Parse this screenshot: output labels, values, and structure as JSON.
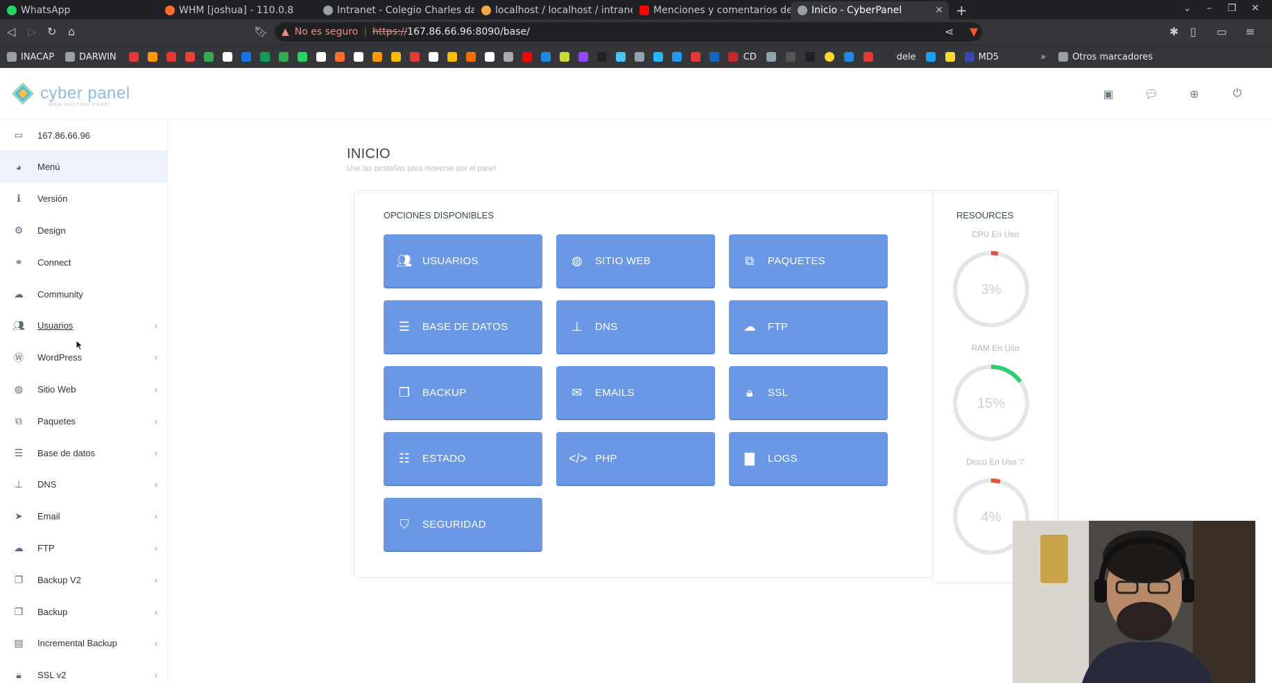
{
  "browser": {
    "tabs": [
      {
        "title": "WhatsApp",
        "color": "#25d366"
      },
      {
        "title": "WHM [joshua] - 110.0.8",
        "color": "#ff6c2c"
      },
      {
        "title": "Intranet - Colegio Charles dar",
        "color": "#9aa0a6"
      },
      {
        "title": "localhost / localhost / intranet",
        "color": "#f4a742"
      },
      {
        "title": "Menciones y comentarios del",
        "color": "#ff0000"
      },
      {
        "title": "Inicio - CyberPanel",
        "color": "#9aa0a6"
      }
    ],
    "security_label": "No es seguro",
    "url_scheme": "https://",
    "url_rest": "167.86.66.96:8090/base/",
    "bookmarks": [
      {
        "label": "INACAP"
      },
      {
        "label": "DARWIN"
      }
    ],
    "bookmark_text_items": [
      "CD",
      "dele",
      "MD5"
    ],
    "other_bookmarks": "Otros marcadores"
  },
  "header": {
    "logo_text": "cyber panel",
    "logo_sub": "WEB HOSTING PANEL",
    "icons": [
      "youtube-icon",
      "chat-icon",
      "support-icon",
      "power-icon"
    ]
  },
  "sidebar": {
    "ip": "167.86.66.96",
    "items": [
      {
        "label": "Menú",
        "icon": "dashboard-icon",
        "chevron": false
      },
      {
        "label": "Versión",
        "icon": "info-icon",
        "chevron": false
      },
      {
        "label": "Design",
        "icon": "gear-icon",
        "chevron": false
      },
      {
        "label": "Connect",
        "icon": "link-icon",
        "chevron": false
      },
      {
        "label": "Community",
        "icon": "comments-icon",
        "chevron": false
      },
      {
        "label": "Usuarios",
        "icon": "users-icon",
        "chevron": true
      },
      {
        "label": "WordPress",
        "icon": "wordpress-icon",
        "chevron": true
      },
      {
        "label": "Sitio Web",
        "icon": "globe-icon",
        "chevron": true
      },
      {
        "label": "Paquetes",
        "icon": "cubes-icon",
        "chevron": true
      },
      {
        "label": "Base de datos",
        "icon": "database-icon",
        "chevron": true
      },
      {
        "label": "DNS",
        "icon": "sitemap-icon",
        "chevron": true
      },
      {
        "label": "Email",
        "icon": "paper-plane-icon",
        "chevron": true
      },
      {
        "label": "FTP",
        "icon": "cloud-upload-icon",
        "chevron": true
      },
      {
        "label": "Backup V2",
        "icon": "copy-icon",
        "chevron": true
      },
      {
        "label": "Backup",
        "icon": "copy-icon",
        "chevron": true
      },
      {
        "label": "Incremental Backup",
        "icon": "save-icon",
        "chevron": true
      },
      {
        "label": "SSL v2",
        "icon": "lock-icon",
        "chevron": true
      }
    ]
  },
  "main": {
    "title": "INICIO",
    "subtitle": "Use las pestañas para moverse por el panel",
    "options_title": "OPCIONES DISPONIBLES",
    "buttons": [
      {
        "label": "USUARIOS",
        "icon": "users-icon"
      },
      {
        "label": "SITIO WEB",
        "icon": "globe-icon"
      },
      {
        "label": "PAQUETES",
        "icon": "cubes-icon"
      },
      {
        "label": "BASE DE DATOS",
        "icon": "database-icon"
      },
      {
        "label": "DNS",
        "icon": "sitemap-icon"
      },
      {
        "label": "FTP",
        "icon": "cloud-upload-icon"
      },
      {
        "label": "BACKUP",
        "icon": "copy-icon"
      },
      {
        "label": "EMAILS",
        "icon": "envelope-icon"
      },
      {
        "label": "SSL",
        "icon": "lock-icon"
      },
      {
        "label": "ESTADO",
        "icon": "list-icon"
      },
      {
        "label": "PHP",
        "icon": "code-icon"
      },
      {
        "label": "LOGS",
        "icon": "file-icon"
      },
      {
        "label": "SEGURIDAD",
        "icon": "shield-icon"
      }
    ]
  },
  "resources": {
    "title": "RESOURCES",
    "gauges": [
      {
        "label": "CPU En Uso",
        "value_text": "3%",
        "fraction": 0.03,
        "color": "#e74c3c"
      },
      {
        "label": "RAM En Uso",
        "value_text": "15%",
        "fraction": 0.15,
        "color": "#2ecc71"
      },
      {
        "label": "Disco En Uso '/'",
        "value_text": "4%",
        "fraction": 0.04,
        "color": "#e74c3c"
      }
    ]
  },
  "colors": {
    "button_bg": "#6a98e6",
    "chrome_bg": "#202124"
  }
}
